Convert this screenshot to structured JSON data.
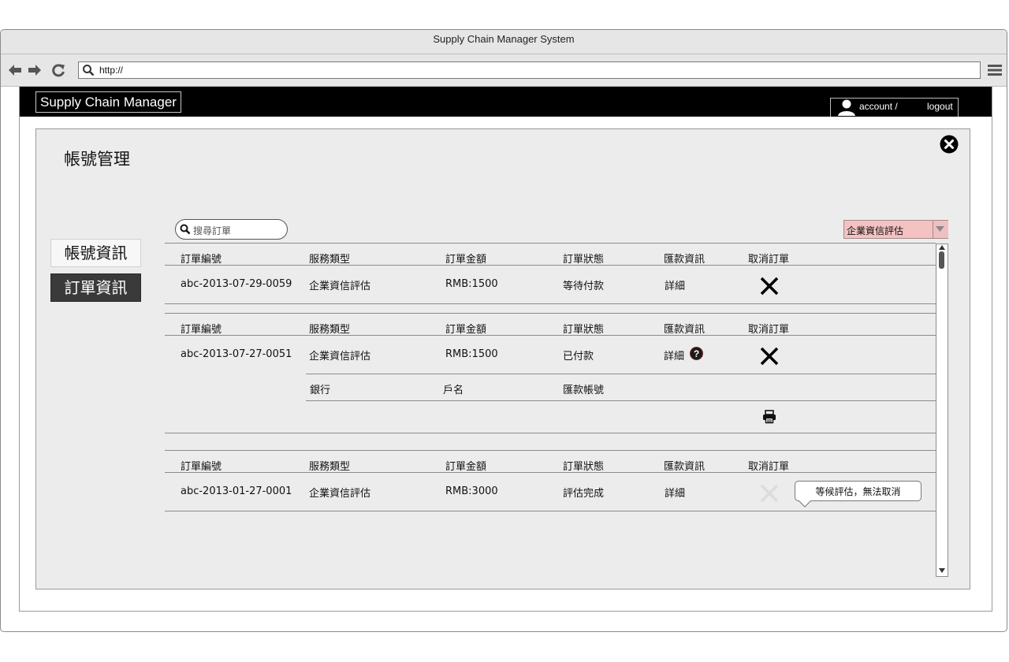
{
  "browser": {
    "title": "Supply Chain Manager System",
    "url": "http://"
  },
  "app": {
    "brand": "Supply Chain Manager",
    "account_label": "account /",
    "logout_label": "logout"
  },
  "panel": {
    "title": "帳號管理",
    "nav": [
      {
        "label": "帳號資訊",
        "active": false
      },
      {
        "label": "訂單資訊",
        "active": true
      }
    ],
    "search_placeholder": "搜尋訂單",
    "filter_value": "企業資信評估"
  },
  "columns": [
    "訂單編號",
    "服務類型",
    "訂單金額",
    "訂單狀態",
    "匯款資訊",
    "取消訂單"
  ],
  "orders": [
    {
      "id": "abc-2013-07-29-0059",
      "service": "企業資信評估",
      "amount": "RMB:1500",
      "status": "等待付款",
      "remit": "詳細",
      "cancel_enabled": true
    },
    {
      "id": "abc-2013-07-27-0051",
      "service": "企業資信評估",
      "amount": "RMB:1500",
      "status": "已付款",
      "remit": "詳細",
      "cancel_enabled": true,
      "detail_columns": [
        "銀行",
        "戶名",
        "匯款帳號"
      ]
    },
    {
      "id": "abc-2013-01-27-0001",
      "service": "企業資信評估",
      "amount": "RMB:3000",
      "status": "評估完成",
      "remit": "詳細",
      "cancel_enabled": false,
      "tooltip": "等候評估，無法取消"
    }
  ]
}
